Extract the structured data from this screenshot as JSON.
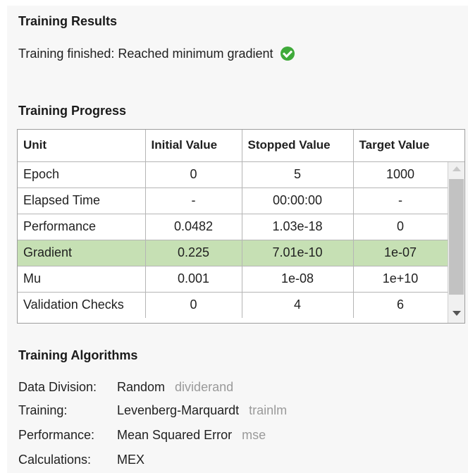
{
  "results": {
    "title": "Training Results",
    "status": "Training finished: Reached minimum gradient",
    "status_icon": "check-circle-icon",
    "status_color": "#3faa3a"
  },
  "progress": {
    "title": "Training Progress",
    "columns": [
      "Unit",
      "Initial Value",
      "Stopped Value",
      "Target Value"
    ],
    "rows": [
      {
        "unit": "Epoch",
        "initial": "0",
        "stopped": "5",
        "target": "1000"
      },
      {
        "unit": "Elapsed Time",
        "initial": "-",
        "stopped": "00:00:00",
        "target": "-"
      },
      {
        "unit": "Performance",
        "initial": "0.0482",
        "stopped": "1.03e-18",
        "target": "0"
      },
      {
        "unit": "Gradient",
        "initial": "0.225",
        "stopped": "7.01e-10",
        "target": "1e-07"
      },
      {
        "unit": "Mu",
        "initial": "0.001",
        "stopped": "1e-08",
        "target": "1e+10"
      },
      {
        "unit": "Validation Checks",
        "initial": "0",
        "stopped": "4",
        "target": "6"
      }
    ],
    "highlight_color": "#c6e0b4"
  },
  "algorithms": {
    "title": "Training Algorithms",
    "items": [
      {
        "label": "Data Division:",
        "value": "Random",
        "fn": "dividerand"
      },
      {
        "label": "Training:",
        "value": "Levenberg-Marquardt",
        "fn": "trainlm"
      },
      {
        "label": "Performance:",
        "value": "Mean Squared Error",
        "fn": "mse"
      },
      {
        "label": "Calculations:",
        "value": "MEX",
        "fn": ""
      }
    ]
  }
}
